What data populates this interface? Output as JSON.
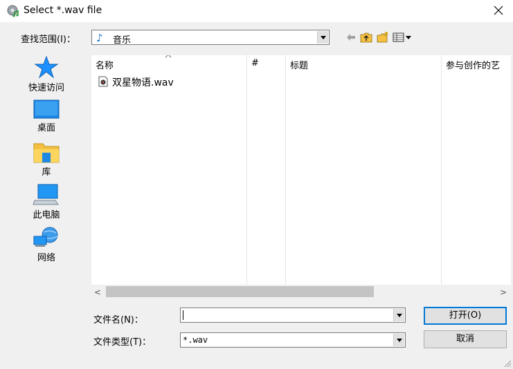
{
  "window": {
    "title": "Select *.wav file"
  },
  "toolbar": {
    "lookin_label": "查找范围(I)：",
    "lookin_value": "音乐"
  },
  "places": [
    {
      "label": "快速访问",
      "icon": "star-icon"
    },
    {
      "label": "桌面",
      "icon": "desktop-icon"
    },
    {
      "label": "库",
      "icon": "library-folder-icon"
    },
    {
      "label": "此电脑",
      "icon": "computer-icon"
    },
    {
      "label": "网络",
      "icon": "network-icon"
    }
  ],
  "filelist": {
    "columns": [
      "名称",
      "#",
      "标题",
      "参与创作的艺"
    ],
    "files": [
      {
        "name": "双星物语.wav",
        "icon": "audio-file-icon"
      }
    ]
  },
  "filename": {
    "label": "文件名(N)：",
    "value": ""
  },
  "filetype": {
    "label": "文件类型(T)：",
    "value": "*.wav"
  },
  "buttons": {
    "open": "打开(O)",
    "cancel": "取消"
  },
  "colors": {
    "accent": "#0078d7",
    "star": "#1e90ff",
    "folder": "#f4c042"
  }
}
